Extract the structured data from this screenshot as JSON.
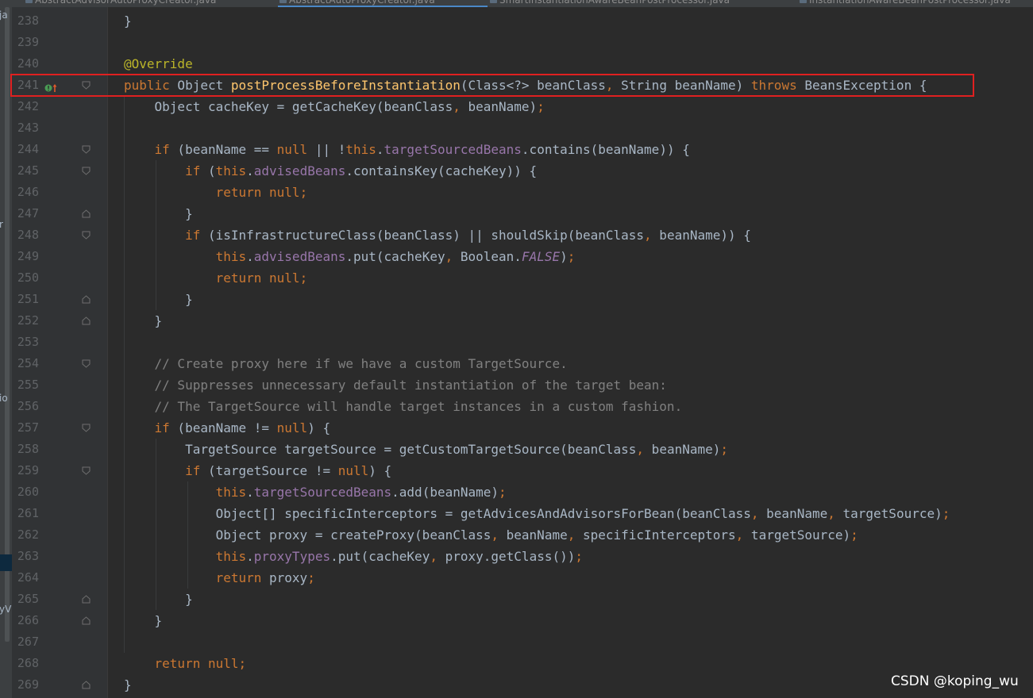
{
  "tabs": [
    {
      "label": "AbstractAdvisorAutoProxyCreator.java",
      "active": false
    },
    {
      "label": "AbstractAutoProxyCreator.java",
      "active": true
    },
    {
      "label": "SmartInstantiationAwareBeanPostProcessor.java",
      "active": false
    },
    {
      "label": "InstantiationAwareBeanPostProcessor.java",
      "active": false
    }
  ],
  "left_strip_fragments": [
    "ja",
    "r",
    "io",
    "yV"
  ],
  "editor": {
    "lines": [
      {
        "n": "238",
        "text": "}"
      },
      {
        "n": "239",
        "text": ""
      },
      {
        "n": "240",
        "text": "@Override"
      },
      {
        "n": "241",
        "text": "public Object postProcessBeforeInstantiation(Class<?> beanClass, String beanName) throws BeansException {"
      },
      {
        "n": "242",
        "text": "    Object cacheKey = getCacheKey(beanClass, beanName);"
      },
      {
        "n": "243",
        "text": ""
      },
      {
        "n": "244",
        "text": "    if (beanName == null || !this.targetSourcedBeans.contains(beanName)) {"
      },
      {
        "n": "245",
        "text": "        if (this.advisedBeans.containsKey(cacheKey)) {"
      },
      {
        "n": "246",
        "text": "            return null;"
      },
      {
        "n": "247",
        "text": "        }"
      },
      {
        "n": "248",
        "text": "        if (isInfrastructureClass(beanClass) || shouldSkip(beanClass, beanName)) {"
      },
      {
        "n": "249",
        "text": "            this.advisedBeans.put(cacheKey, Boolean.FALSE);"
      },
      {
        "n": "250",
        "text": "            return null;"
      },
      {
        "n": "251",
        "text": "        }"
      },
      {
        "n": "252",
        "text": "    }"
      },
      {
        "n": "253",
        "text": ""
      },
      {
        "n": "254",
        "text": "    // Create proxy here if we have a custom TargetSource."
      },
      {
        "n": "255",
        "text": "    // Suppresses unnecessary default instantiation of the target bean:"
      },
      {
        "n": "256",
        "text": "    // The TargetSource will handle target instances in a custom fashion."
      },
      {
        "n": "257",
        "text": "    if (beanName != null) {"
      },
      {
        "n": "258",
        "text": "        TargetSource targetSource = getCustomTargetSource(beanClass, beanName);"
      },
      {
        "n": "259",
        "text": "        if (targetSource != null) {"
      },
      {
        "n": "260",
        "text": "            this.targetSourcedBeans.add(beanName);"
      },
      {
        "n": "261",
        "text": "            Object[] specificInterceptors = getAdvicesAndAdvisorsForBean(beanClass, beanName, targetSource);"
      },
      {
        "n": "262",
        "text": "            Object proxy = createProxy(beanClass, beanName, specificInterceptors, targetSource);"
      },
      {
        "n": "263",
        "text": "            this.proxyTypes.put(cacheKey, proxy.getClass());"
      },
      {
        "n": "264",
        "text": "            return proxy;"
      },
      {
        "n": "265",
        "text": "        }"
      },
      {
        "n": "266",
        "text": "    }"
      },
      {
        "n": "267",
        "text": ""
      },
      {
        "n": "268",
        "text": "    return null;"
      },
      {
        "n": "269",
        "text": "}"
      }
    ],
    "fold_lines": [
      "241",
      "244",
      "245",
      "247",
      "248",
      "251",
      "252",
      "254",
      "257",
      "259",
      "265",
      "266",
      "269"
    ],
    "highlighted_line": "241",
    "override_icon": "override-up-arrow-icon"
  },
  "watermark": "CSDN @koping_wu",
  "colors": {
    "background": "#2b2b2b",
    "gutter": "#313335",
    "keyword": "#cc7832",
    "annotation": "#bbb529",
    "method": "#ffc66d",
    "field": "#9876aa",
    "comment": "#808080",
    "text": "#a9b7c6",
    "highlight_box": "#e02020"
  }
}
